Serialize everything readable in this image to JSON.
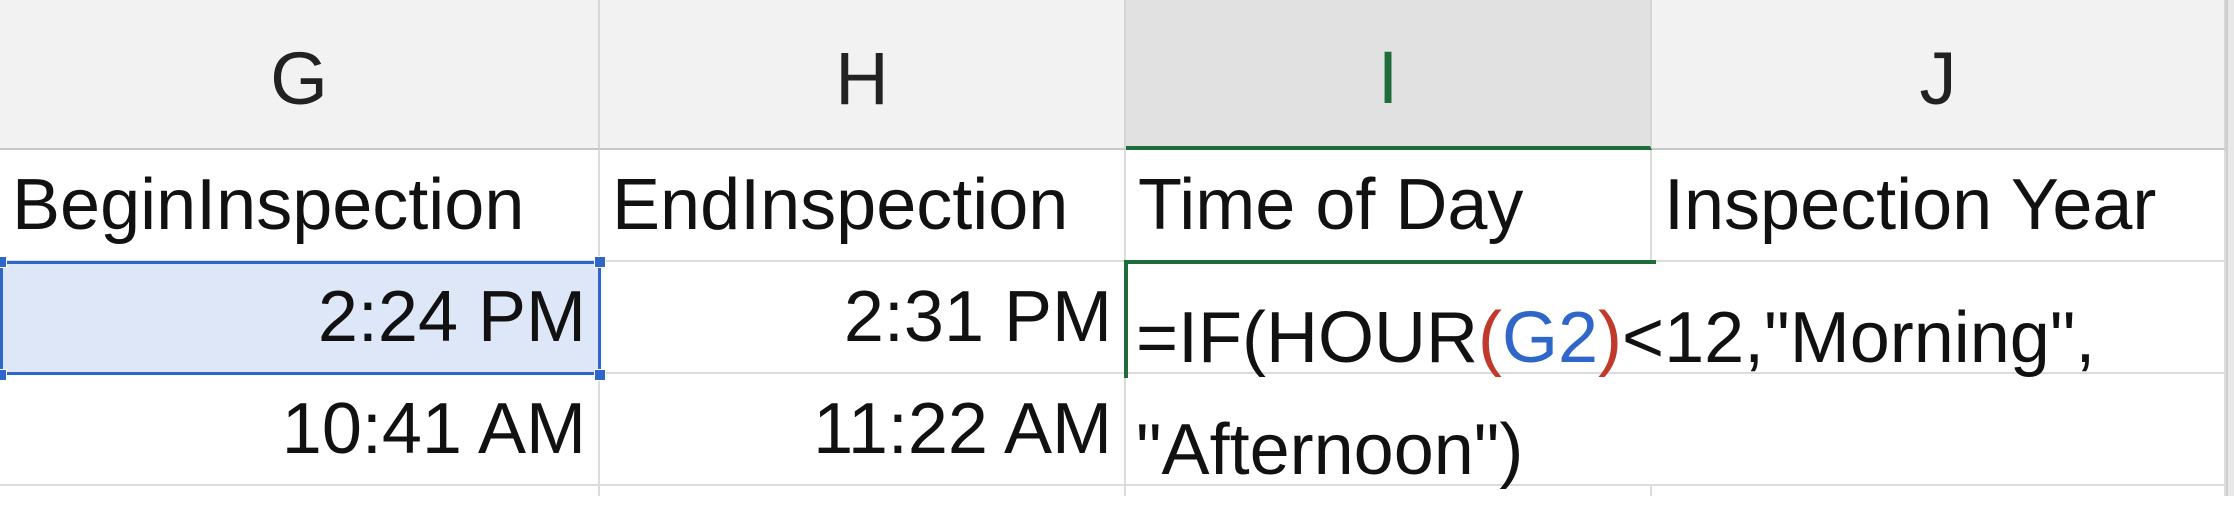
{
  "columns": [
    {
      "letter": "G",
      "selected": false
    },
    {
      "letter": "H",
      "selected": false
    },
    {
      "letter": "I",
      "selected": true
    },
    {
      "letter": "J",
      "selected": false
    }
  ],
  "rows": [
    {
      "G": "BeginInspection",
      "H": "EndInspection",
      "I": "Time of Day",
      "J": "Inspection Year"
    },
    {
      "G": "2:24 PM",
      "H": "2:31 PM",
      "I": "",
      "J": ""
    },
    {
      "G": "10:41 AM",
      "H": "11:22 AM",
      "I": "",
      "J": ""
    }
  ],
  "formula": {
    "prefix": "=IF(HOUR",
    "open_paren": "(",
    "ref": "G2",
    "close_paren": ")",
    "mid": "<12,\"Morning\",",
    "line2": "\"Afternoon\")"
  },
  "colors": {
    "selection_blue": "#2f66c9",
    "edit_green": "#1e6b3b",
    "ref_red": "#c0392b",
    "highlight": "#dde7f7"
  }
}
